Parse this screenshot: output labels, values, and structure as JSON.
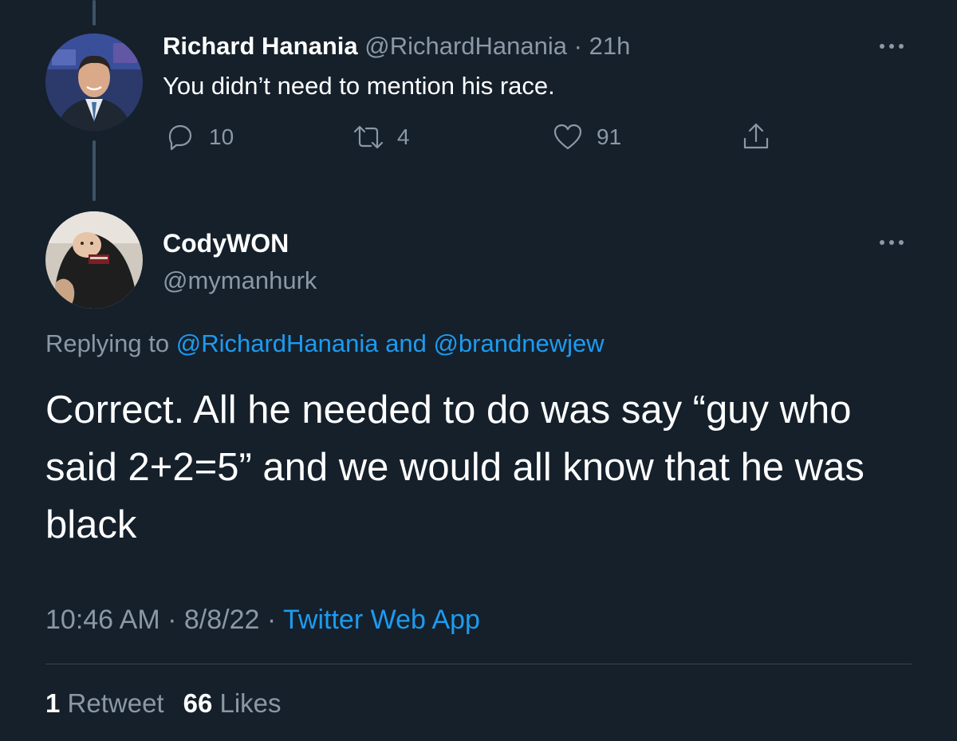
{
  "parent_tweet": {
    "name": "Richard Hanania",
    "handle": "@RichardHanania",
    "separator": " · ",
    "time": "21h",
    "text": "You didn’t need to mention his race.",
    "reply_count": "10",
    "retweet_count": "4",
    "like_count": "91"
  },
  "main_tweet": {
    "name": "CodyWON",
    "handle": "@mymanhurk",
    "replying_prefix": "Replying to ",
    "reply_to_1": "@RichardHanania",
    "replying_and": " and ",
    "reply_to_2": "@brandnewjew",
    "text": "Correct. All he needed to do was say “guy who said 2+2=5” and we would all know that he was black",
    "time": "10:46 AM",
    "dot1": " · ",
    "date": "8/8/22",
    "dot2": " · ",
    "source": "Twitter Web App",
    "retweets_count": "1",
    "retweets_label": " Retweet",
    "likes_count": "66",
    "likes_label": " Likes"
  },
  "icons": {
    "reply": "reply-icon",
    "retweet": "retweet-icon",
    "like": "heart-icon",
    "share": "share-icon",
    "more": "more-icon"
  },
  "colors": {
    "background": "#15202b",
    "primary_text": "#ffffff",
    "secondary_text": "#8b98a5",
    "link": "#1d9bf0",
    "divider": "#38444d"
  }
}
